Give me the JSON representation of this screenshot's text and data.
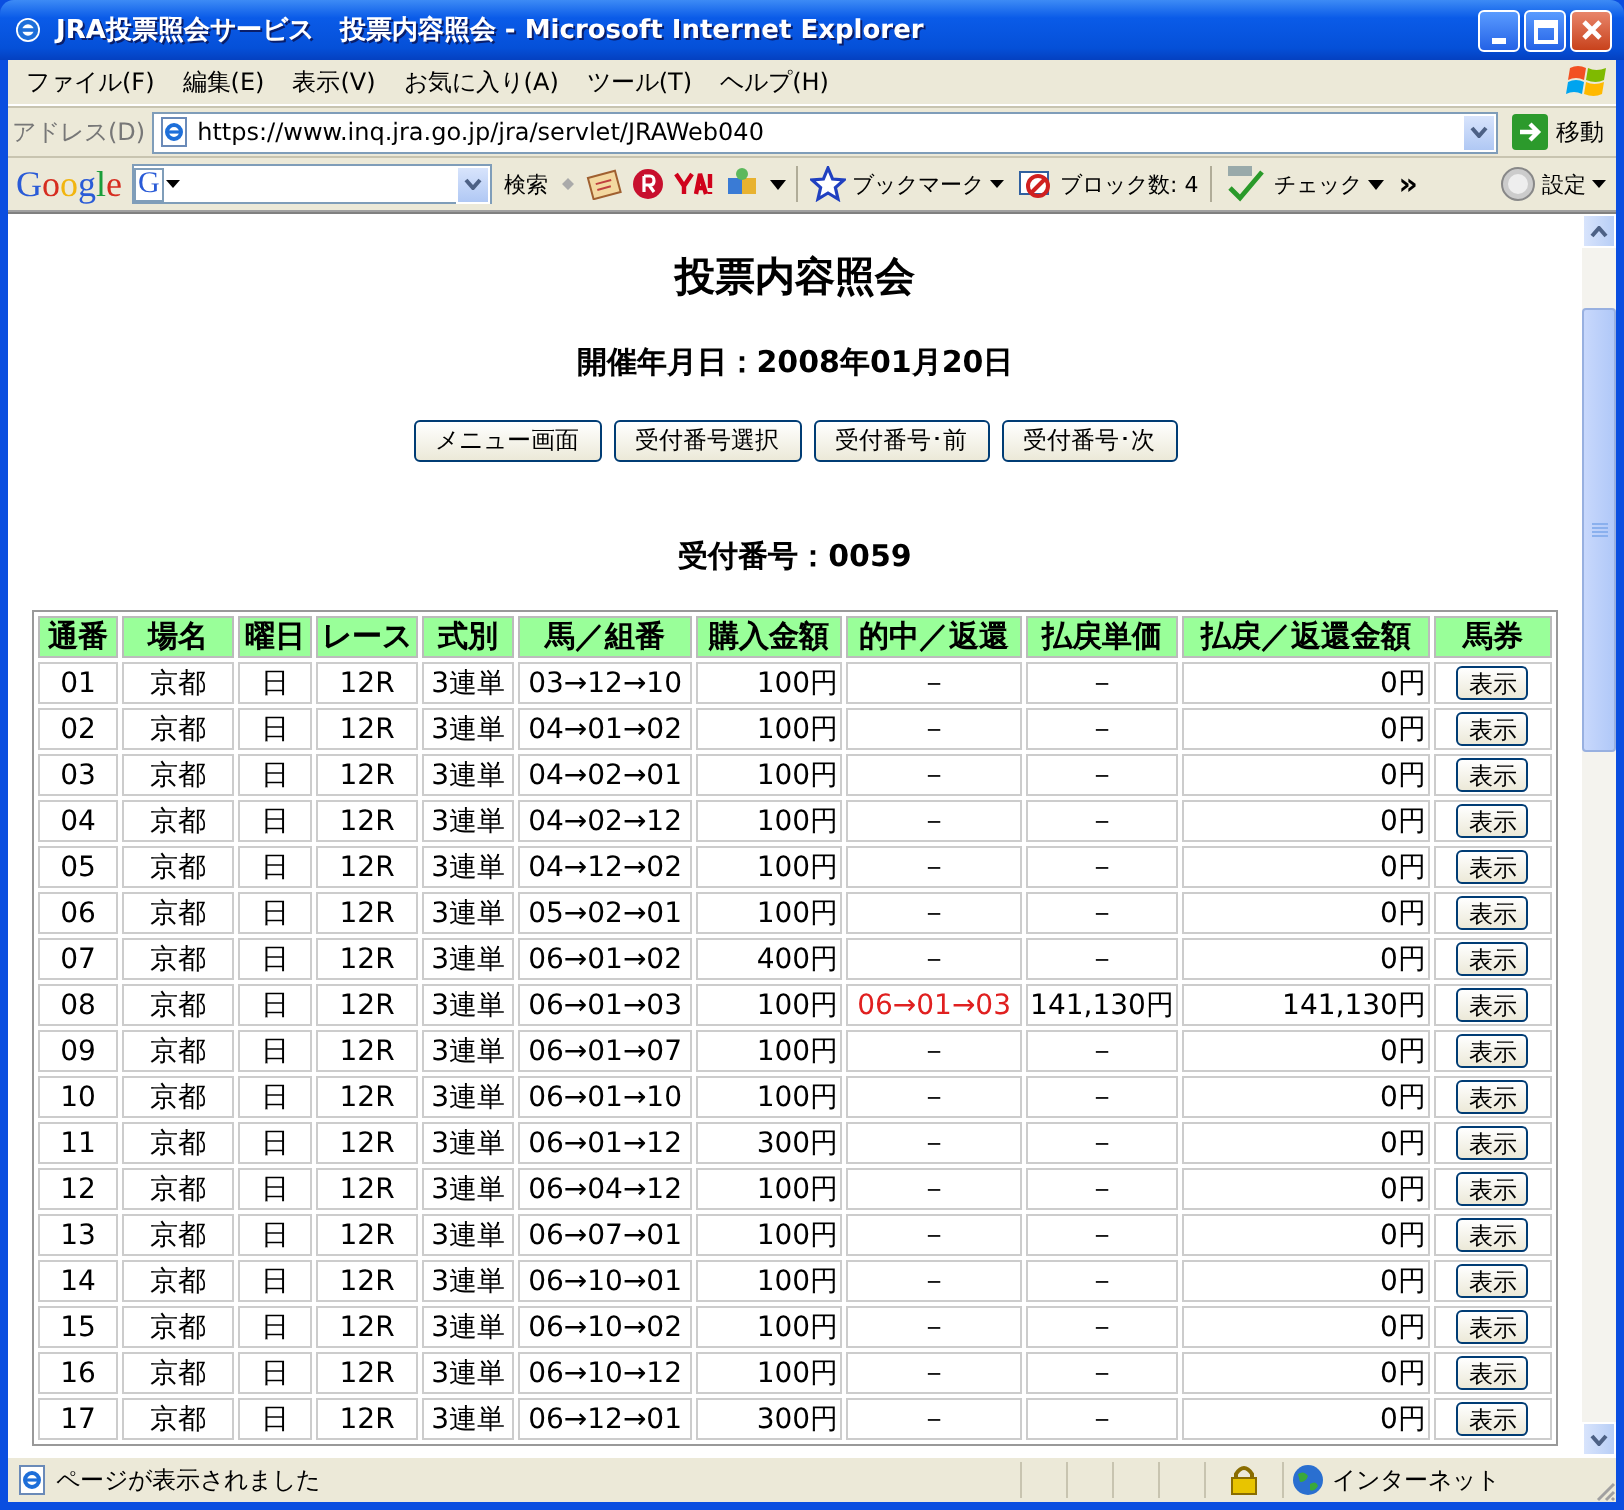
{
  "window": {
    "title": "JRA投票照会サービス　投票内容照会 - Microsoft Internet Explorer"
  },
  "menu": [
    "ファイル(F)",
    "編集(E)",
    "表示(V)",
    "お気に入り(A)",
    "ツール(T)",
    "ヘルプ(H)"
  ],
  "address_bar": {
    "label": "アドレス(D)",
    "url": "https://www.inq.jra.go.jp/jra/servlet/JRAWeb040",
    "go_label": "移動"
  },
  "google_toolbar": {
    "logo": "Google",
    "engine_badge": "G",
    "search_label": "検索",
    "bookmarks_label": "ブックマーク",
    "block_label": "ブロック数: 4",
    "check_label": "チェック",
    "more": "»",
    "settings_label": "設定"
  },
  "page": {
    "heading": "投票内容照会",
    "date_line": "開催年月日：2008年01月20日",
    "buttons": [
      "メニュー画面",
      "受付番号選択",
      "受付番号･前",
      "受付番号･次"
    ],
    "receipt_line": "受付番号：0059",
    "table": {
      "columns": [
        "通番",
        "場名",
        "曜日",
        "レース",
        "式別",
        "馬／組番",
        "購入金額",
        "的中／返還",
        "払戻単価",
        "払戻／返還金額",
        "馬券"
      ],
      "rows": [
        {
          "cells": [
            "01",
            "京都",
            "日",
            "12R",
            "3連単",
            "03→12→10",
            "100円",
            "－",
            "－",
            "0円"
          ],
          "button": "表示",
          "hit": false
        },
        {
          "cells": [
            "02",
            "京都",
            "日",
            "12R",
            "3連単",
            "04→01→02",
            "100円",
            "－",
            "－",
            "0円"
          ],
          "button": "表示",
          "hit": false
        },
        {
          "cells": [
            "03",
            "京都",
            "日",
            "12R",
            "3連単",
            "04→02→01",
            "100円",
            "－",
            "－",
            "0円"
          ],
          "button": "表示",
          "hit": false
        },
        {
          "cells": [
            "04",
            "京都",
            "日",
            "12R",
            "3連単",
            "04→02→12",
            "100円",
            "－",
            "－",
            "0円"
          ],
          "button": "表示",
          "hit": false
        },
        {
          "cells": [
            "05",
            "京都",
            "日",
            "12R",
            "3連単",
            "04→12→02",
            "100円",
            "－",
            "－",
            "0円"
          ],
          "button": "表示",
          "hit": false
        },
        {
          "cells": [
            "06",
            "京都",
            "日",
            "12R",
            "3連単",
            "05→02→01",
            "100円",
            "－",
            "－",
            "0円"
          ],
          "button": "表示",
          "hit": false
        },
        {
          "cells": [
            "07",
            "京都",
            "日",
            "12R",
            "3連単",
            "06→01→02",
            "400円",
            "－",
            "－",
            "0円"
          ],
          "button": "表示",
          "hit": false
        },
        {
          "cells": [
            "08",
            "京都",
            "日",
            "12R",
            "3連単",
            "06→01→03",
            "100円",
            "06→01→03",
            "141,130円",
            "141,130円"
          ],
          "button": "表示",
          "hit": true
        },
        {
          "cells": [
            "09",
            "京都",
            "日",
            "12R",
            "3連単",
            "06→01→07",
            "100円",
            "－",
            "－",
            "0円"
          ],
          "button": "表示",
          "hit": false
        },
        {
          "cells": [
            "10",
            "京都",
            "日",
            "12R",
            "3連単",
            "06→01→10",
            "100円",
            "－",
            "－",
            "0円"
          ],
          "button": "表示",
          "hit": false
        },
        {
          "cells": [
            "11",
            "京都",
            "日",
            "12R",
            "3連単",
            "06→01→12",
            "300円",
            "－",
            "－",
            "0円"
          ],
          "button": "表示",
          "hit": false
        },
        {
          "cells": [
            "12",
            "京都",
            "日",
            "12R",
            "3連単",
            "06→04→12",
            "100円",
            "－",
            "－",
            "0円"
          ],
          "button": "表示",
          "hit": false
        },
        {
          "cells": [
            "13",
            "京都",
            "日",
            "12R",
            "3連単",
            "06→07→01",
            "100円",
            "－",
            "－",
            "0円"
          ],
          "button": "表示",
          "hit": false
        },
        {
          "cells": [
            "14",
            "京都",
            "日",
            "12R",
            "3連単",
            "06→10→01",
            "100円",
            "－",
            "－",
            "0円"
          ],
          "button": "表示",
          "hit": false
        },
        {
          "cells": [
            "15",
            "京都",
            "日",
            "12R",
            "3連単",
            "06→10→02",
            "100円",
            "－",
            "－",
            "0円"
          ],
          "button": "表示",
          "hit": false
        },
        {
          "cells": [
            "16",
            "京都",
            "日",
            "12R",
            "3連単",
            "06→10→12",
            "100円",
            "－",
            "－",
            "0円"
          ],
          "button": "表示",
          "hit": false
        },
        {
          "cells": [
            "17",
            "京都",
            "日",
            "12R",
            "3連単",
            "06→12→01",
            "300円",
            "－",
            "－",
            "0円"
          ],
          "button": "表示",
          "hit": false
        }
      ]
    }
  },
  "status_bar": {
    "text": "ページが表示されました",
    "zone": "インターネット"
  }
}
